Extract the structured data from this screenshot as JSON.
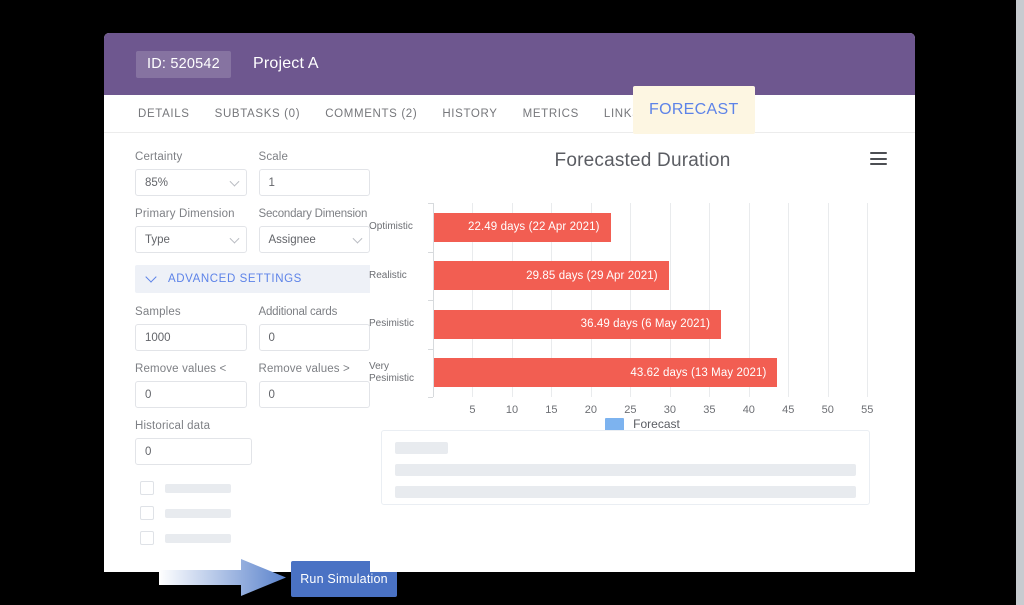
{
  "header": {
    "id_badge": "ID: 520542",
    "project_title": "Project A",
    "bg_color": "#6e578f"
  },
  "tabs": [
    {
      "label": "DETAILS",
      "active": false
    },
    {
      "label": "SUBTASKS (0)",
      "active": false
    },
    {
      "label": "COMMENTS (2)",
      "active": false
    },
    {
      "label": "HISTORY",
      "active": false
    },
    {
      "label": "METRICS",
      "active": false
    },
    {
      "label": "LINKS",
      "active": false
    },
    {
      "label": "FORECAST",
      "active": true
    }
  ],
  "form": {
    "certainty": {
      "label": "Certainty",
      "value": "85%"
    },
    "scale": {
      "label": "Scale",
      "value": "1"
    },
    "primary_dimension": {
      "label": "Primary Dimension",
      "value": "Type"
    },
    "secondary_dimension": {
      "label": "Secondary Dimension",
      "value": "Assignee"
    },
    "advanced_settings_label": "ADVANCED SETTINGS",
    "samples": {
      "label": "Samples",
      "value": "1000"
    },
    "additional_cards": {
      "label": "Additional cards",
      "value": "0"
    },
    "remove_values_lt": {
      "label": "Remove values <",
      "value": "0"
    },
    "remove_values_gt": {
      "label": "Remove values >",
      "value": "0"
    },
    "historical_data": {
      "label": "Historical data",
      "value": "0"
    },
    "run_button_label": "Run Simulation",
    "run_button_color": "#4a72c4"
  },
  "chart_data": {
    "type": "bar",
    "orientation": "horizontal",
    "title": "Forecasted Duration",
    "xlabel": "",
    "ylabel": "",
    "categories": [
      "Optimistic",
      "Realistic",
      "Pesimistic",
      "Very\nPesimistic"
    ],
    "values": [
      22.49,
      29.85,
      36.49,
      43.62
    ],
    "data_labels": [
      "22.49 days (22 Apr 2021)",
      "29.85 days (29 Apr 2021)",
      "36.49 days (6 May 2021)",
      "43.62 days (13 May 2021)"
    ],
    "xticks": [
      5,
      10,
      15,
      20,
      25,
      30,
      35,
      40,
      45,
      50,
      55
    ],
    "xlim": [
      0,
      57.5
    ],
    "grid": true,
    "legend": {
      "position": "bottom",
      "entries": [
        "Forecast"
      ],
      "swatch_color": "#7db3ef"
    },
    "bar_color": "#f25e52"
  },
  "icons": {
    "menu": "hamburger-menu-icon",
    "chevron_down": "chevron-down-icon"
  }
}
